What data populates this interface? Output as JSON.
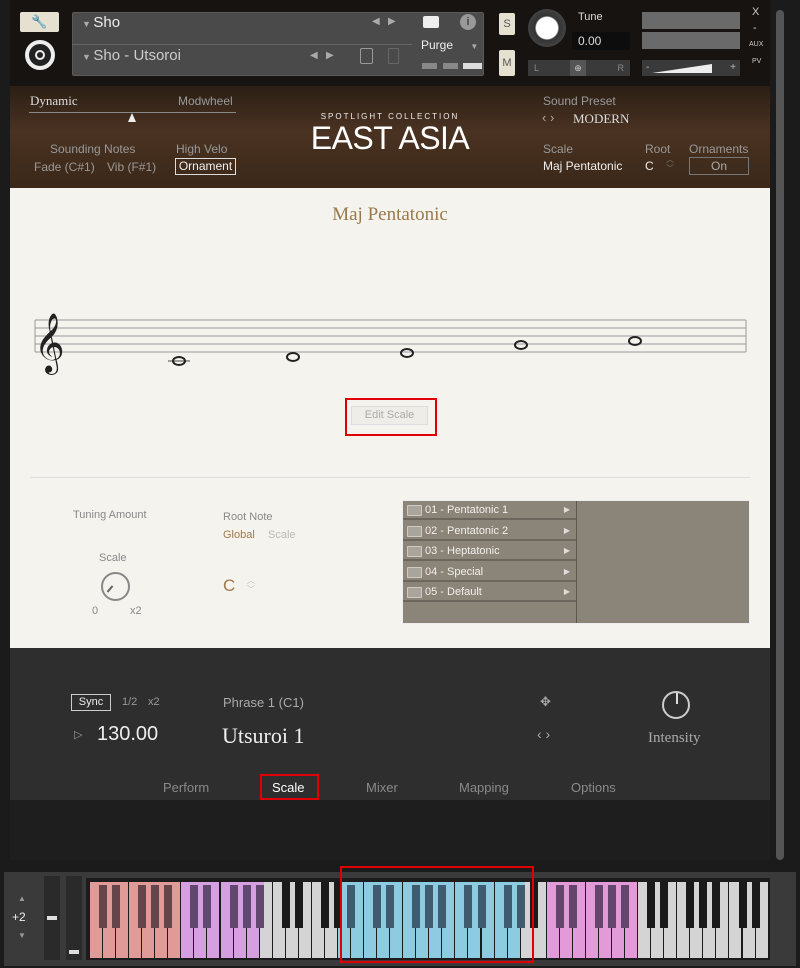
{
  "instrument": {
    "name": "Sho",
    "preset": "Sho - Utsoroi",
    "purge_label": "Purge",
    "solo": "S",
    "mute": "M",
    "tune_label": "Tune",
    "tune_value": "0.00",
    "pan_l": "L",
    "pan_r": "R",
    "vol_minus": "-",
    "vol_plus": "+",
    "close": "X",
    "minimize": "-",
    "aux": "AUX",
    "pv": "PV"
  },
  "header": {
    "dynamic_label": "Dynamic",
    "modwheel_label": "Modwheel",
    "sounding_notes_label": "Sounding Notes",
    "fade": "Fade (C#1)",
    "vib": "Vib (F#1)",
    "high_velo_label": "High Velo",
    "ornament_btn": "Ornament",
    "brand_sub": "SPOTLIGHT COLLECTION",
    "brand": "EAST ASIA",
    "sound_preset_label": "Sound Preset",
    "sound_preset_value": "MODERN",
    "scale_label": "Scale",
    "scale_value": "Maj Pentatonic",
    "root_label": "Root",
    "root_value": "C",
    "ornaments_label": "Ornaments",
    "ornaments_value": "On",
    "dynamic_level": 0.5
  },
  "scale_view": {
    "title": "Maj Pentatonic",
    "notes": [
      "C4",
      "D4",
      "E4",
      "G4",
      "A4"
    ],
    "edit_button": "Edit Scale"
  },
  "tuning": {
    "label": "Tuning Amount",
    "knob_label": "Scale",
    "min": "0",
    "max": "x2"
  },
  "root_note": {
    "label": "Root Note",
    "opt_global": "Global",
    "opt_scale": "Scale",
    "value": "C"
  },
  "folders": [
    "01 - Pentatonic 1",
    "02 - Pentatonic 2",
    "03 - Heptatonic",
    "04 - Special",
    "05 - Default"
  ],
  "perform": {
    "sync": "Sync",
    "half": "1/2",
    "double": "x2",
    "tempo": "130.00",
    "phrase_label": "Phrase 1 (C1)",
    "phrase_name": "Utsuroi 1",
    "intensity": "Intensity"
  },
  "tabs": [
    "Perform",
    "Scale",
    "Mixer",
    "Mapping",
    "Options"
  ],
  "active_tab": "Scale",
  "keyboard": {
    "octave": "+2",
    "zones": [
      {
        "color": "#e09a98",
        "count": 7
      },
      {
        "color": "#d6a0e0",
        "count": 6
      },
      {
        "color": "#d4d4d4",
        "count": 6
      },
      {
        "color": "#8ccbe0",
        "count": 14
      },
      {
        "color": "#d4d4d4",
        "count": 2
      },
      {
        "color": "#e29ad8",
        "count": 7
      },
      {
        "color": "#d4d4d4",
        "count": 10
      }
    ]
  }
}
